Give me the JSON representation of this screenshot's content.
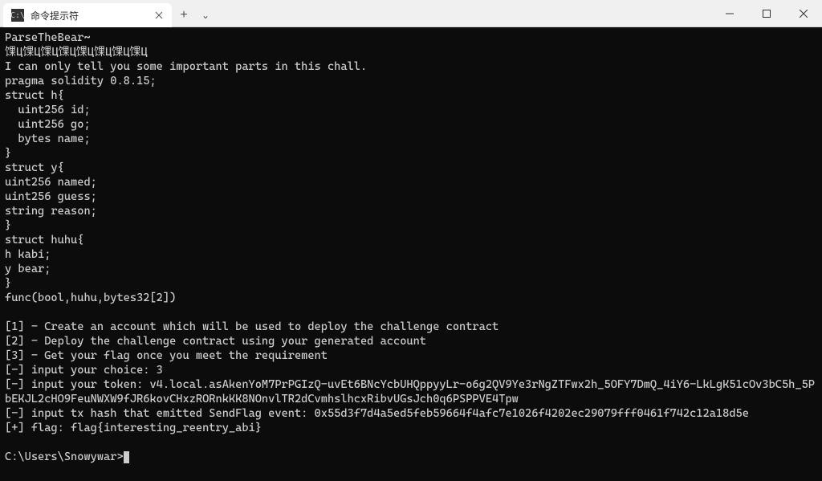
{
  "titleBar": {
    "tab": {
      "title": "命令提示符",
      "iconText": "C:\\"
    },
    "addLabel": "+",
    "dropdownLabel": "⌄"
  },
  "terminal": {
    "lines": [
      "ParseTheBear~",
      "馃Ц馃Ц馃Ц馃Ц馃Ц馃Ц馃Ц馃Ц",
      "I can only tell you some important parts in this chall.",
      "pragma solidity 0.8.15;",
      "struct h{",
      "  uint256 id;",
      "  uint256 go;",
      "  bytes name;",
      "}",
      "struct y{",
      "uint256 named;",
      "uint256 guess;",
      "string reason;",
      "}",
      "struct huhu{",
      "h kabi;",
      "y bear;",
      "}",
      "func(bool,huhu,bytes32[2])",
      "",
      "[1] - Create an account which will be used to deploy the challenge contract",
      "[2] - Deploy the challenge contract using your generated account",
      "[3] - Get your flag once you meet the requirement",
      "[-] input your choice: 3",
      "[-] input your token: v4.local.asAkenYoM7PrPGIzQ-uvEt6BNcYcbUHQppyyLr-o6g2QV9Ye3rNgZTFwx2h_5OFY7DmQ_4iY6-LkLgK51cOv3bC5h_5PbEKJL2cHO9FeuNWXW9fJR6kovCHxzRORnkKK8NOnvlTR2dCvmhslhcxRibvUGsJch0q6PSPPVE4Tpw",
      "[-] input tx hash that emitted SendFlag event: 0x55d3f7d4a5ed5feb59664f4afc7e1026f4202ec29079fff0461f742c12a18d5e",
      "[+] flag: flag{interesting_reentry_abi}",
      ""
    ],
    "prompt": "C:\\Users\\Snowywar>"
  }
}
